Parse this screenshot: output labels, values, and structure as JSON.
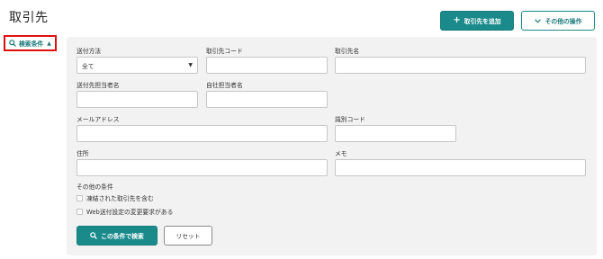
{
  "header": {
    "title": "取引先",
    "add_button": "取引先を追加",
    "other_ops_button": "その他の操作"
  },
  "toggle": {
    "label": "検索条件"
  },
  "form": {
    "send_method": {
      "label": "送付方法",
      "value": "全て"
    },
    "partner_code": {
      "label": "取引先コード",
      "value": ""
    },
    "partner_name": {
      "label": "取引先名",
      "value": ""
    },
    "partner_contact": {
      "label": "送付先担当者名",
      "value": ""
    },
    "own_contact": {
      "label": "自社担当者名",
      "value": ""
    },
    "email": {
      "label": "メールアドレス",
      "value": ""
    },
    "identifier_code": {
      "label": "識別コード",
      "value": ""
    },
    "address": {
      "label": "住所",
      "value": ""
    },
    "memo": {
      "label": "メモ",
      "value": ""
    },
    "other_conditions": {
      "label": "その他の条件",
      "checkboxes": [
        {
          "label": "凍結された取引先を含む",
          "checked": false
        },
        {
          "label": "Web送付設定の変更要求がある",
          "checked": false
        }
      ]
    }
  },
  "actions": {
    "search_button": "この条件で検索",
    "reset_button": "リセット"
  },
  "colors": {
    "accent": "#1a8a8a",
    "highlight_border": "#e01010",
    "panel_bg": "#f2f2f2"
  }
}
